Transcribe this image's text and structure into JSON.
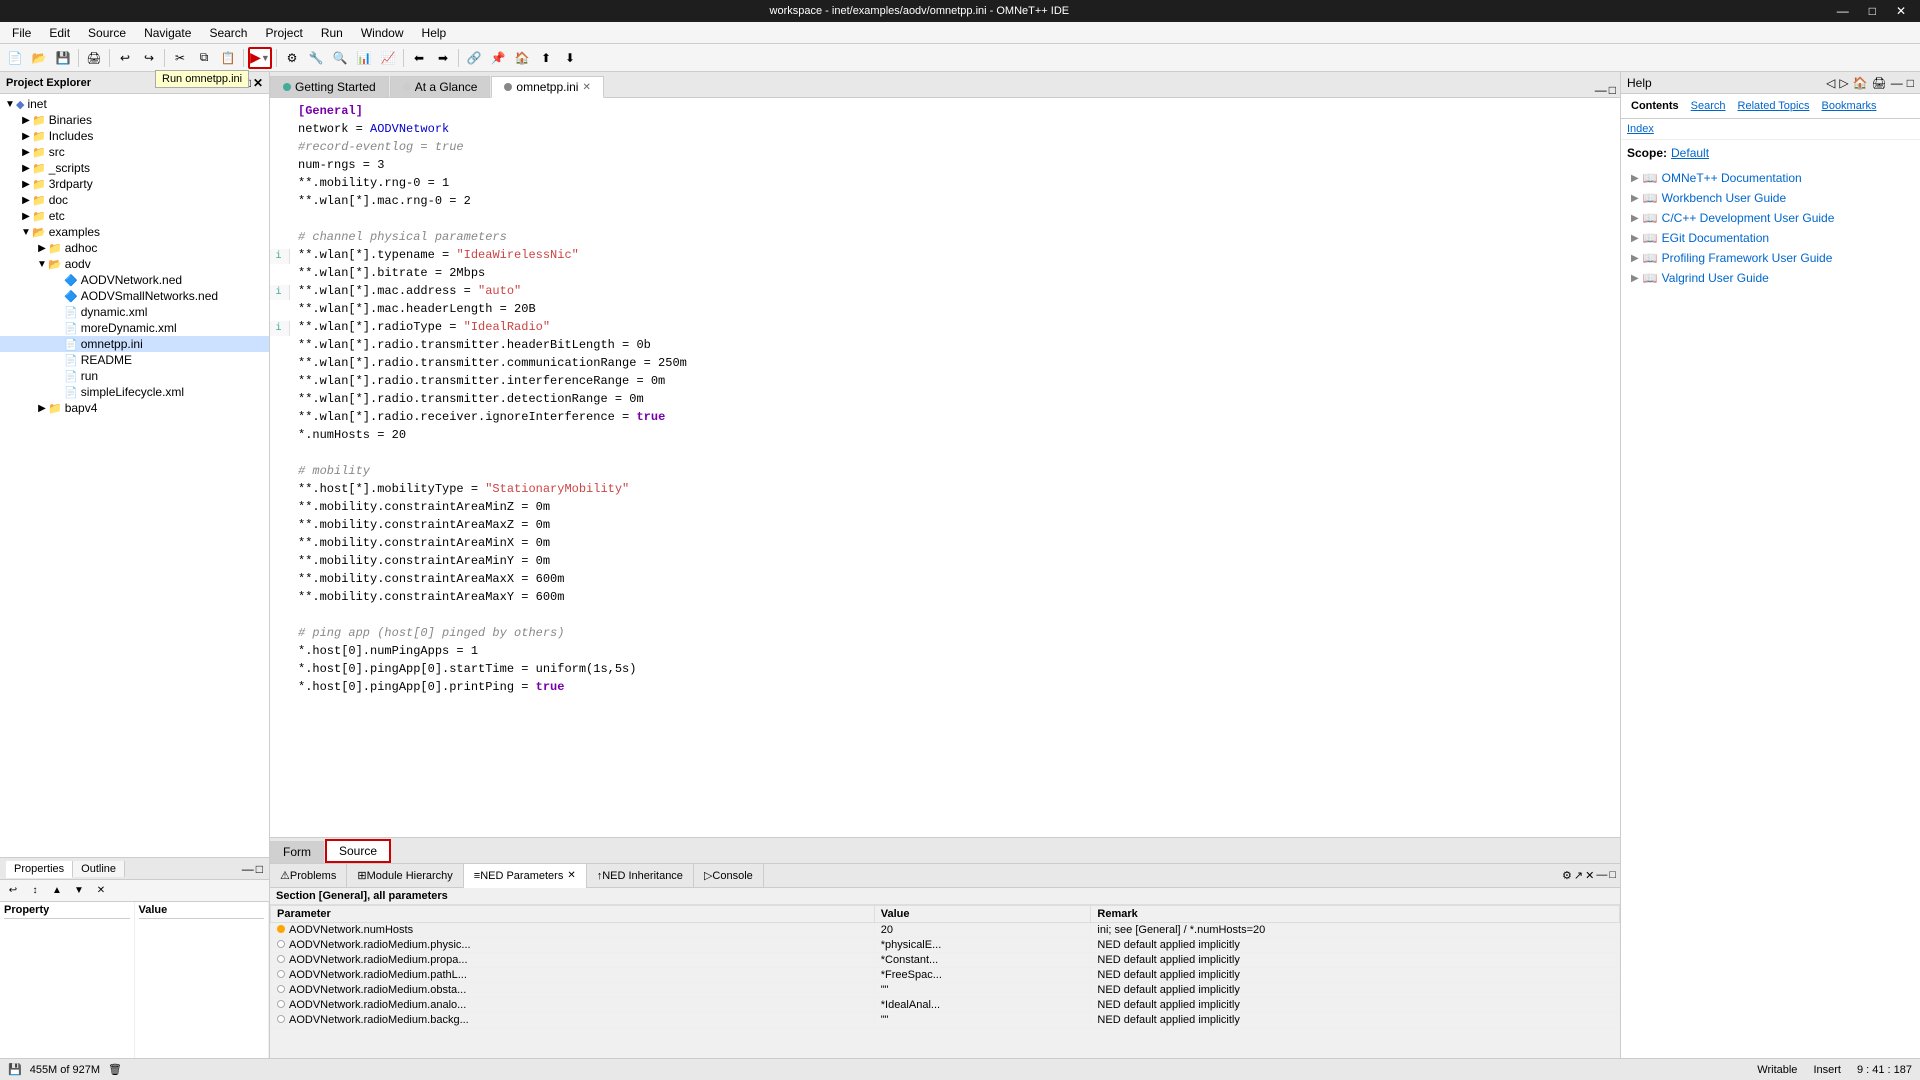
{
  "titleBar": {
    "title": "workspace - inet/examples/aodv/omnetpp.ini - OMNeT++ IDE",
    "minimize": "—",
    "maximize": "□",
    "close": "✕"
  },
  "menuBar": {
    "items": [
      "File",
      "Edit",
      "Source",
      "Navigate",
      "Search",
      "Project",
      "Run",
      "Window",
      "Help"
    ]
  },
  "tooltip": {
    "text": "Run omnetpp.ini"
  },
  "projectExplorer": {
    "title": "Project Explorer",
    "tree": [
      {
        "label": "inet",
        "level": 0,
        "type": "project",
        "expanded": true
      },
      {
        "label": "Binaries",
        "level": 1,
        "type": "folder",
        "expanded": false
      },
      {
        "label": "Includes",
        "level": 1,
        "type": "folder",
        "expanded": false
      },
      {
        "label": "src",
        "level": 1,
        "type": "folder",
        "expanded": false
      },
      {
        "label": "_scripts",
        "level": 1,
        "type": "folder",
        "expanded": false
      },
      {
        "label": "3rdparty",
        "level": 1,
        "type": "folder",
        "expanded": false
      },
      {
        "label": "doc",
        "level": 1,
        "type": "folder",
        "expanded": false
      },
      {
        "label": "etc",
        "level": 1,
        "type": "folder",
        "expanded": false
      },
      {
        "label": "examples",
        "level": 1,
        "type": "folder",
        "expanded": true
      },
      {
        "label": "adhoc",
        "level": 2,
        "type": "folder",
        "expanded": false
      },
      {
        "label": "aodv",
        "level": 2,
        "type": "folder",
        "expanded": true
      },
      {
        "label": "AODVNetwork.ned",
        "level": 3,
        "type": "file-ned"
      },
      {
        "label": "AODVSmallNetworks.ned",
        "level": 3,
        "type": "file-ned"
      },
      {
        "label": "dynamic.xml",
        "level": 3,
        "type": "file-xml"
      },
      {
        "label": "moreDynamic.xml",
        "level": 3,
        "type": "file-xml"
      },
      {
        "label": "omnetpp.ini",
        "level": 3,
        "type": "file-ini",
        "selected": true
      },
      {
        "label": "README",
        "level": 3,
        "type": "file"
      },
      {
        "label": "run",
        "level": 3,
        "type": "file"
      },
      {
        "label": "simpleLifecycle.xml",
        "level": 3,
        "type": "file-xml"
      },
      {
        "label": "bapv4",
        "level": 2,
        "type": "folder",
        "expanded": false
      }
    ]
  },
  "properties": {
    "title": "Properties",
    "tabs": [
      "Properties",
      "Outline"
    ],
    "activeTab": "Properties",
    "columns": [
      "Property",
      "Value"
    ]
  },
  "editorTabs": [
    {
      "label": "Getting Started",
      "active": false,
      "closable": false
    },
    {
      "label": "At a Glance",
      "active": false,
      "closable": false
    },
    {
      "label": "omnetpp.ini",
      "active": true,
      "closable": true
    }
  ],
  "codeLines": [
    {
      "gutter": "",
      "marker": false,
      "content": "[General]",
      "type": "keyword"
    },
    {
      "gutter": "",
      "marker": false,
      "content": "network = AODVNetwork",
      "type": "normal"
    },
    {
      "gutter": "",
      "marker": false,
      "content": "#record-eventlog = true",
      "type": "comment"
    },
    {
      "gutter": "",
      "marker": false,
      "content": "num-rngs = 3",
      "type": "normal"
    },
    {
      "gutter": "",
      "marker": false,
      "content": "**.mobility.rng-0 = 1",
      "type": "normal"
    },
    {
      "gutter": "",
      "marker": false,
      "content": "**.wlan[*].mac.rng-0 = 2",
      "type": "normal"
    },
    {
      "gutter": "",
      "marker": false,
      "content": "",
      "type": "normal"
    },
    {
      "gutter": "",
      "marker": false,
      "content": "# channel physical parameters",
      "type": "comment"
    },
    {
      "gutter": "i",
      "marker": true,
      "content": "**.wlan[*].typename = \"IdeaWirelessNic\"",
      "type": "string"
    },
    {
      "gutter": "",
      "marker": false,
      "content": "**.wlan[*].bitrate = 2Mbps",
      "type": "normal"
    },
    {
      "gutter": "i",
      "marker": true,
      "content": "**.wlan[*].mac.address = \"auto\"",
      "type": "string"
    },
    {
      "gutter": "",
      "marker": false,
      "content": "**.wlan[*].mac.headerLength = 20B",
      "type": "normal"
    },
    {
      "gutter": "i",
      "marker": true,
      "content": "**.wlan[*].radioType = \"IdealRadio\"",
      "type": "string"
    },
    {
      "gutter": "",
      "marker": false,
      "content": "**.wlan[*].radio.transmitter.headerBitLength = 0b",
      "type": "normal"
    },
    {
      "gutter": "",
      "marker": false,
      "content": "**.wlan[*].radio.transmitter.communicationRange = 250m",
      "type": "normal"
    },
    {
      "gutter": "",
      "marker": false,
      "content": "**.wlan[*].radio.transmitter.interferenceRange = 0m",
      "type": "normal"
    },
    {
      "gutter": "",
      "marker": false,
      "content": "**.wlan[*].radio.transmitter.detectionRange = 0m",
      "type": "normal"
    },
    {
      "gutter": "",
      "marker": false,
      "content": "**.wlan[*].radio.receiver.ignoreInterference = true",
      "type": "bool"
    },
    {
      "gutter": "",
      "marker": false,
      "content": "*.numHosts = 20",
      "type": "normal"
    },
    {
      "gutter": "",
      "marker": false,
      "content": "",
      "type": "normal"
    },
    {
      "gutter": "",
      "marker": false,
      "content": "# mobility",
      "type": "comment"
    },
    {
      "gutter": "",
      "marker": false,
      "content": "**.host[*].mobilityType = \"StationaryMobility\"",
      "type": "string"
    },
    {
      "gutter": "",
      "marker": false,
      "content": "**.mobility.constraintAreaMinZ = 0m",
      "type": "normal"
    },
    {
      "gutter": "",
      "marker": false,
      "content": "**.mobility.constraintAreaMaxZ = 0m",
      "type": "normal"
    },
    {
      "gutter": "",
      "marker": false,
      "content": "**.mobility.constraintAreaMinX = 0m",
      "type": "normal"
    },
    {
      "gutter": "",
      "marker": false,
      "content": "**.mobility.constraintAreaMinY = 0m",
      "type": "normal"
    },
    {
      "gutter": "",
      "marker": false,
      "content": "**.mobility.constraintAreaMaxX = 600m",
      "type": "normal"
    },
    {
      "gutter": "",
      "marker": false,
      "content": "**.mobility.constraintAreaMaxY = 600m",
      "type": "normal"
    },
    {
      "gutter": "",
      "marker": false,
      "content": "",
      "type": "normal"
    },
    {
      "gutter": "",
      "marker": false,
      "content": "# ping app (host[0] pinged by others)",
      "type": "comment"
    },
    {
      "gutter": "",
      "marker": false,
      "content": "*.host[0].numPingApps = 1",
      "type": "normal"
    },
    {
      "gutter": "",
      "marker": false,
      "content": "*.host[0].pingApp[0].startTime = uniform(1s,5s)",
      "type": "normal"
    },
    {
      "gutter": "",
      "marker": false,
      "content": "*.host[0].pingApp[0].printPing = true",
      "type": "bool"
    }
  ],
  "bottomTabs": {
    "form": "Form",
    "source": "Source"
  },
  "paramsTabs": [
    {
      "label": "Problems",
      "active": false
    },
    {
      "label": "Module Hierarchy",
      "active": false
    },
    {
      "label": "NED Parameters",
      "active": true
    },
    {
      "label": "NED Inheritance",
      "active": false
    },
    {
      "label": "Console",
      "active": false
    }
  ],
  "paramsSection": "Section [General], all parameters",
  "paramsColumns": [
    "Parameter",
    "Value",
    "Remark"
  ],
  "paramsRows": [
    {
      "bullet": "yellow",
      "param": "AODVNetwork.numHosts",
      "value": "20",
      "remark": "ini; see [General] / *.numHosts=20"
    },
    {
      "bullet": "white",
      "param": "AODVNetwork.radioMedium.physic...",
      "value": "*physicalE...",
      "remark": "NED default applied implicitly"
    },
    {
      "bullet": "white",
      "param": "AODVNetwork.radioMedium.propa...",
      "value": "*Constant...",
      "remark": "NED default applied implicitly"
    },
    {
      "bullet": "white",
      "param": "AODVNetwork.radioMedium.pathL...",
      "value": "*FreeSpac...",
      "remark": "NED default applied implicitly"
    },
    {
      "bullet": "white",
      "param": "AODVNetwork.radioMedium.obsta...",
      "value": "\"\"",
      "remark": "NED default applied implicitly"
    },
    {
      "bullet": "white",
      "param": "AODVNetwork.radioMedium.analo...",
      "value": "*IdealAnal...",
      "remark": "NED default applied implicitly"
    },
    {
      "bullet": "white",
      "param": "AODVNetwork.radioMedium.backg...",
      "value": "\"\"",
      "remark": "NED default applied implicitly"
    }
  ],
  "help": {
    "title": "Help",
    "tabs": [
      "Contents",
      "Search",
      "Related Topics",
      "Bookmarks"
    ],
    "activeTab": "Contents",
    "indexLabel": "Index",
    "scope": {
      "label": "Scope:",
      "value": "Default"
    },
    "sections": [
      {
        "label": "OMNeT++ Documentation",
        "expanded": false
      },
      {
        "label": "Workbench User Guide",
        "expanded": false
      },
      {
        "label": "C/C++ Development User Guide",
        "expanded": false
      },
      {
        "label": "EGit Documentation",
        "expanded": false
      },
      {
        "label": "Profiling Framework User Guide",
        "expanded": false
      },
      {
        "label": "Valgrind User Guide",
        "expanded": false
      }
    ]
  },
  "statusBar": {
    "memory": "455M of 927M",
    "writable": "Writable",
    "insert": "Insert",
    "position": "9 : 41 : 187"
  }
}
